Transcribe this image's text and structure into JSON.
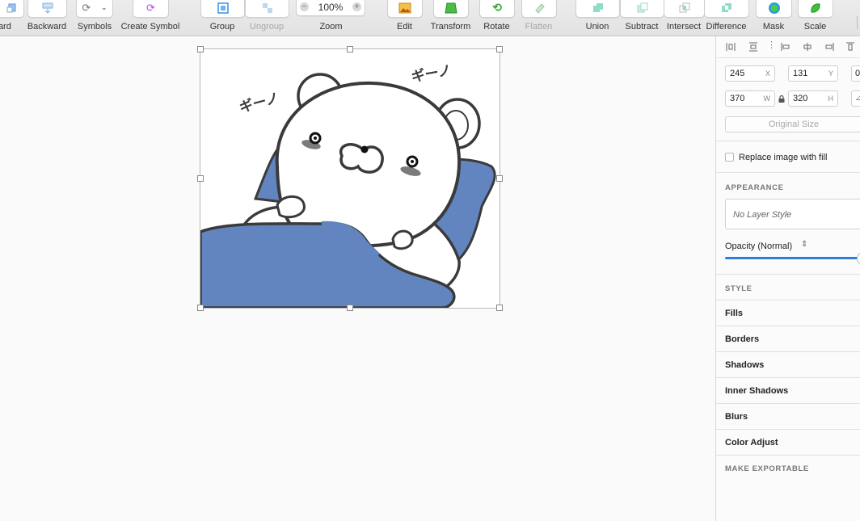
{
  "toolbar": {
    "items": [
      {
        "label": "ward",
        "name": "forward"
      },
      {
        "label": "Backward",
        "name": "backward"
      },
      {
        "label": "Symbols",
        "name": "symbols"
      },
      {
        "label": "Create Symbol",
        "name": "create-symbol"
      },
      {
        "label": "Group",
        "name": "group"
      },
      {
        "label": "Ungroup",
        "name": "ungroup",
        "disabled": true
      },
      {
        "label": "Zoom",
        "name": "zoom"
      },
      {
        "label": "Edit",
        "name": "edit"
      },
      {
        "label": "Transform",
        "name": "transform"
      },
      {
        "label": "Rotate",
        "name": "rotate"
      },
      {
        "label": "Flatten",
        "name": "flatten",
        "disabled": true
      },
      {
        "label": "Union",
        "name": "union"
      },
      {
        "label": "Subtract",
        "name": "subtract"
      },
      {
        "label": "Intersect",
        "name": "intersect"
      },
      {
        "label": "Difference",
        "name": "difference"
      },
      {
        "label": "Mask",
        "name": "mask"
      },
      {
        "label": "Scale",
        "name": "scale"
      }
    ],
    "zoom_value": "100%",
    "zoom_minus": "−",
    "zoom_plus": "+"
  },
  "inspector": {
    "x": {
      "value": "245",
      "suffix": "X"
    },
    "y": {
      "value": "131",
      "suffix": "Y"
    },
    "rotation": {
      "value": "0"
    },
    "w": {
      "value": "370",
      "suffix": "W"
    },
    "h": {
      "value": "320",
      "suffix": "H"
    },
    "original_size": "Original Size",
    "replace_fill": "Replace image with fill",
    "appearance_header": "APPEARANCE",
    "layer_style": "No Layer Style",
    "opacity_label": "Opacity (Normal)",
    "opacity": 1.0,
    "style_header": "STYLE",
    "style_sections": [
      "Fills",
      "Borders",
      "Shadows",
      "Inner Shadows",
      "Blurs",
      "Color Adjust"
    ],
    "exportable_header": "MAKE EXPORTABLE"
  },
  "artwork": {
    "sfx_left": "ギーノ",
    "sfx_right": "ギーノ"
  },
  "colors": {
    "accent": "#2f7ed8",
    "blanket": "#6285c0",
    "outline": "#3a3a3a"
  }
}
